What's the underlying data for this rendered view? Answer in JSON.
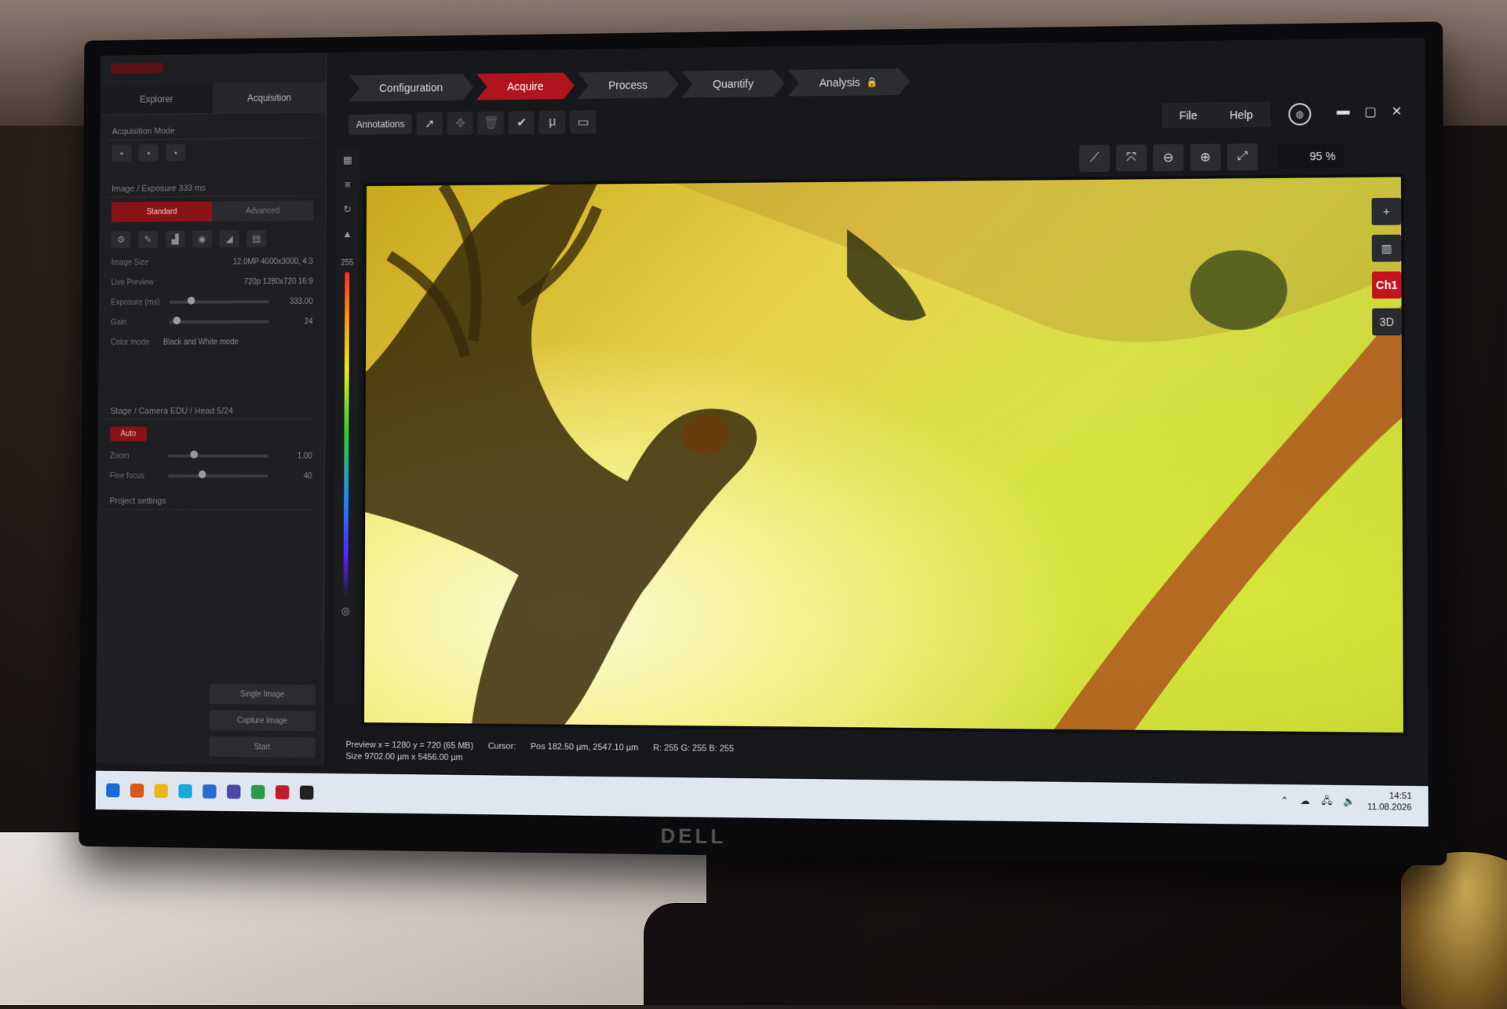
{
  "workflow": {
    "tabs": [
      {
        "label": "Configuration"
      },
      {
        "label": "Acquire",
        "active": true
      },
      {
        "label": "Process"
      },
      {
        "label": "Quantify"
      },
      {
        "label": "Analysis"
      }
    ]
  },
  "toolbar": {
    "annotations_label": "Annotations",
    "tools": [
      "select-icon",
      "move-icon",
      "delete-icon",
      "check-icon",
      "scalebar-icon",
      "rectangle-icon"
    ]
  },
  "menu": {
    "file": "File",
    "help": "Help"
  },
  "view_tools": {
    "zoom_value": "95 %",
    "icons": [
      "measure-icon",
      "xyz-icon",
      "zoom-out-icon",
      "zoom-in-icon",
      "fit-icon"
    ]
  },
  "left_panel": {
    "tabs": [
      "Explorer",
      "Acquisition"
    ],
    "sections": {
      "acq_mode": "Acquisition Mode",
      "image": "Image / Exposure 333 ms",
      "seg_standard": "Standard",
      "seg_advanced": "Advanced",
      "image_size_label": "Image Size",
      "image_size_value": "12.0MP 4000x3000, 4:3",
      "live_preview_label": "Live Preview",
      "live_preview_value": "720p 1280x720 16:9",
      "exposure_label": "Exposure (ms)",
      "exposure_value": "333.00",
      "gain_label": "Gain",
      "gain_value": "24",
      "color_mode_label": "Color mode",
      "color_mode_value": "Black and White mode",
      "stage": "Stage / Camera EDU / Head 5/24",
      "stage_pill": "Auto",
      "zoom_label": "Zoom",
      "zoom_value": "1.00",
      "focus_label": "Fine focus",
      "focus_value": "40",
      "project_settings": "Project settings"
    },
    "bottom_buttons": [
      "Single Image",
      "Capture Image",
      "Start"
    ]
  },
  "right_tools": [
    "+",
    "palette",
    "Ch1",
    "3D"
  ],
  "vstrip": {
    "level_label": "255"
  },
  "status": {
    "preview": "Preview x = 1280 y = 720 (65 MB)",
    "size": "Size 9702.00 µm x 5456.00 µm",
    "cursor": "Cursor:",
    "pos": "Pos 182.50 µm, 2547.10 µm",
    "rgb": "R: 255 G: 255 B: 255"
  },
  "taskbar": {
    "time": "14:51",
    "date": "11.08.2026"
  },
  "bezel_brand": "DELL",
  "colors": {
    "accent": "#b0141c",
    "panel": "#1e1f22",
    "image_bg": "#e8d24a"
  }
}
